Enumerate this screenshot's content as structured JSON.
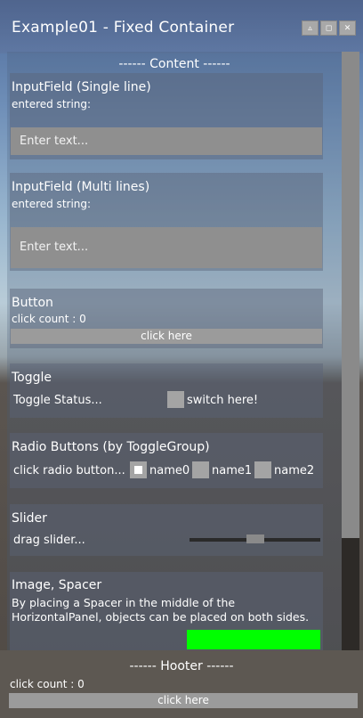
{
  "window": {
    "title": "Example01 - Fixed Container",
    "buttons": [
      "▵",
      "◻",
      "✕"
    ]
  },
  "content": {
    "header": "------ Content ------",
    "input_single": {
      "title": "InputField (Single line)",
      "entered_label": "entered string:",
      "placeholder": "Enter text..."
    },
    "input_multi": {
      "title": "InputField (Multi lines)",
      "entered_label": "entered string:",
      "placeholder": "Enter text..."
    },
    "button": {
      "title": "Button",
      "count_text": "click count : 0",
      "label": "click here"
    },
    "toggle": {
      "title": "Toggle",
      "status": "Toggle Status...",
      "label": "switch here!",
      "checked": false
    },
    "radio": {
      "title": "Radio Buttons (by ToggleGroup)",
      "status": "click radio button...",
      "options": [
        {
          "label": "name0",
          "selected": true
        },
        {
          "label": "name1",
          "selected": false
        },
        {
          "label": "name2",
          "selected": false
        }
      ]
    },
    "slider": {
      "title": "Slider",
      "status": "drag slider...",
      "value": 0.5
    },
    "image_spacer": {
      "title": "Image, Spacer",
      "desc_line1": "By placing a Spacer in the middle of the",
      "desc_line2": "HorizontalPanel, objects can be placed on both sides.",
      "image_color": "#00ff00"
    }
  },
  "scroll": {
    "position": 0.0
  },
  "footer": {
    "header": "------ Hooter ------",
    "count_text": "click count : 0",
    "button_label": "click here"
  }
}
